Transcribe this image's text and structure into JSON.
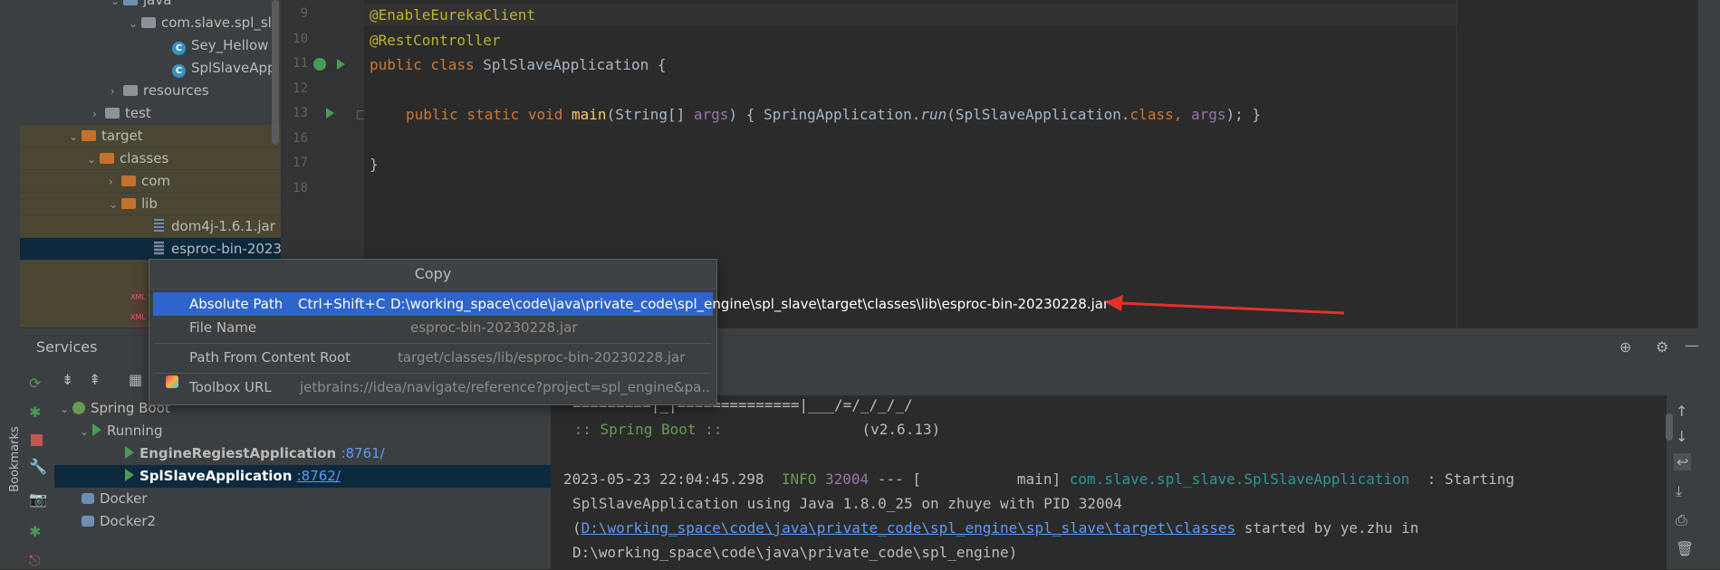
{
  "bookmarks_label": "Bookmarks",
  "project_tree": [
    {
      "label": "java",
      "type": "folder-blue"
    },
    {
      "label": "com.slave.spl_sla",
      "type": "package"
    },
    {
      "label": "Sey_Hellow",
      "type": "class"
    },
    {
      "label": "SplSlaveAppli",
      "type": "class"
    },
    {
      "label": "resources",
      "type": "folder-grey"
    },
    {
      "label": "test",
      "type": "folder-grey"
    },
    {
      "label": "target",
      "type": "folder-orange"
    },
    {
      "label": "classes",
      "type": "folder-orange"
    },
    {
      "label": "com",
      "type": "folder-orange"
    },
    {
      "label": "lib",
      "type": "folder-orange"
    },
    {
      "label": "dom4j-1.6.1.jar",
      "type": "jar"
    },
    {
      "label": "esproc-bin-2023",
      "type": "jar"
    }
  ],
  "editor": {
    "line_numbers": [
      "9",
      "10",
      "11",
      "12",
      "13",
      "16",
      "17",
      "18"
    ],
    "lines": {
      "l9": "@EnableEurekaClient",
      "l10": "@RestController",
      "l11_kw": "public class ",
      "l11_name": "SplSlaveApplication",
      "l11_brace": " {",
      "l13_kw": "public static void ",
      "l13_fn": "main",
      "l13_sig": "(String[] ",
      "l13_param": "args",
      "l13_open": ") { ",
      "l13_cls": "SpringApplication.",
      "l13_run": "run",
      "l13_arg1": "(SplSlaveApplication.",
      "l13_class_kw": "class",
      "l13_comma": ", ",
      "l13_args": "args",
      "l13_end": "); }",
      "l17": "}"
    }
  },
  "copy_popup": {
    "title": "Copy",
    "items": [
      {
        "label": "Absolute Path",
        "shortcut": "Ctrl+Shift+C",
        "value": "D:\\working_space\\code\\java\\private_code\\spl_engine\\spl_slave\\target\\classes\\lib\\esproc-bin-20230228.jar"
      },
      {
        "label": "File Name",
        "shortcut": "",
        "value": "esproc-bin-20230228.jar"
      },
      {
        "label": "Path From Content Root",
        "shortcut": "",
        "value": "target/classes/lib/esproc-bin-20230228.jar"
      },
      {
        "label": "Toolbox URL",
        "shortcut": "",
        "value": "jetbrains://idea/navigate/reference?project=spl_engine&pa.."
      }
    ]
  },
  "services": {
    "title": "Services",
    "tree": [
      {
        "label": "Spring Boot"
      },
      {
        "label": "Running"
      },
      {
        "label": "EngineRegiestApplication",
        "port": ":8761/"
      },
      {
        "label": "SplSlaveApplication",
        "port": ":8762/"
      },
      {
        "label": "Docker"
      },
      {
        "label": "Docker2"
      }
    ]
  },
  "console": {
    "banner_line": "=========|_|==============|___/=/_/_/_/",
    "spring_boot": " :: Spring Boot :: ",
    "version": "               (v2.6.13)",
    "log_time": "2023-05-23 22:04:45.298 ",
    "log_level": " INFO ",
    "log_pid": "32004",
    "log_sep": " --- [           main] ",
    "log_logger": "com.slave.spl_slave.SplSlaveApplication",
    "log_msg": "  : Starting",
    "log_line2": "SplSlaveApplication using Java 1.8.0_25 on zhuye with PID 32004",
    "log_line3_open": "(",
    "log_line3_link": "D:\\working_space\\code\\java\\private_code\\spl_engine\\spl_slave\\target\\classes",
    "log_line3_rest": " started by ye.zhu in",
    "log_line4": "D:\\working_space\\code\\java\\private_code\\spl_engine)"
  },
  "colors": {
    "accent_selection": "#2f65ca",
    "arrow": "#e8302a"
  }
}
